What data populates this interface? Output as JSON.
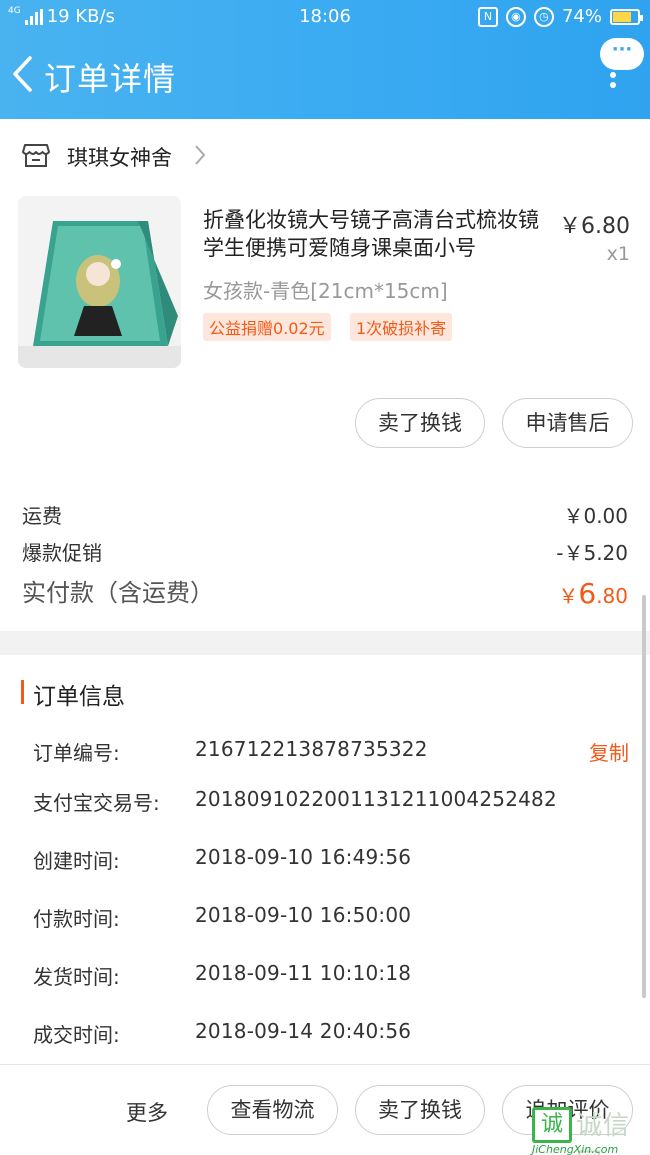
{
  "status_bar": {
    "network": "4G",
    "speed": "19 KB/s",
    "time": "18:06",
    "battery": "74%",
    "battery_level": 0.74
  },
  "header": {
    "title": "订单详情",
    "more_bubble": "···"
  },
  "shop": {
    "name": "琪琪女神舍"
  },
  "product": {
    "title": "折叠化妆镜大号镜子高清台式梳妆镜学生便携可爱随身课桌面小号",
    "price": "￥6.80",
    "qty": "x1",
    "sku": "女孩款-青色[21cm*15cm]",
    "tags": [
      "公益捐赠0.02元",
      "1次破损补寄"
    ]
  },
  "item_actions": {
    "sell": "卖了换钱",
    "after_sale": "申请售后"
  },
  "fees": {
    "shipping_label": "运费",
    "shipping_value": "￥0.00",
    "promo_label": "爆款促销",
    "promo_value": "-￥5.20",
    "total_label": "实付款（含运费）",
    "total_currency": "￥",
    "total_int": "6",
    "total_dec": ".80"
  },
  "order_info": {
    "title": "订单信息",
    "copy": "复制",
    "rows": [
      {
        "k": "订单编号:",
        "v": "216712213878735322"
      },
      {
        "k": "支付宝交易号:",
        "v": "2018091022001131211004252482"
      },
      {
        "k": "创建时间:",
        "v": "2018-09-10 16:49:56"
      },
      {
        "k": "付款时间:",
        "v": "2018-09-10 16:50:00"
      },
      {
        "k": "发货时间:",
        "v": "2018-09-11 10:10:18"
      },
      {
        "k": "成交时间:",
        "v": "2018-09-14 20:40:56"
      }
    ]
  },
  "bottom_bar": {
    "more": "更多",
    "logistics": "查看物流",
    "sell": "卖了换钱",
    "review": "追加评价"
  },
  "watermark": {
    "box": "诚",
    "text": "诚信网",
    "sub": "JiChengXin.com"
  },
  "colors": {
    "header_blue": "#39aaf2",
    "accent_orange": "#f35a1a",
    "tag_bg": "#fde7dc"
  }
}
